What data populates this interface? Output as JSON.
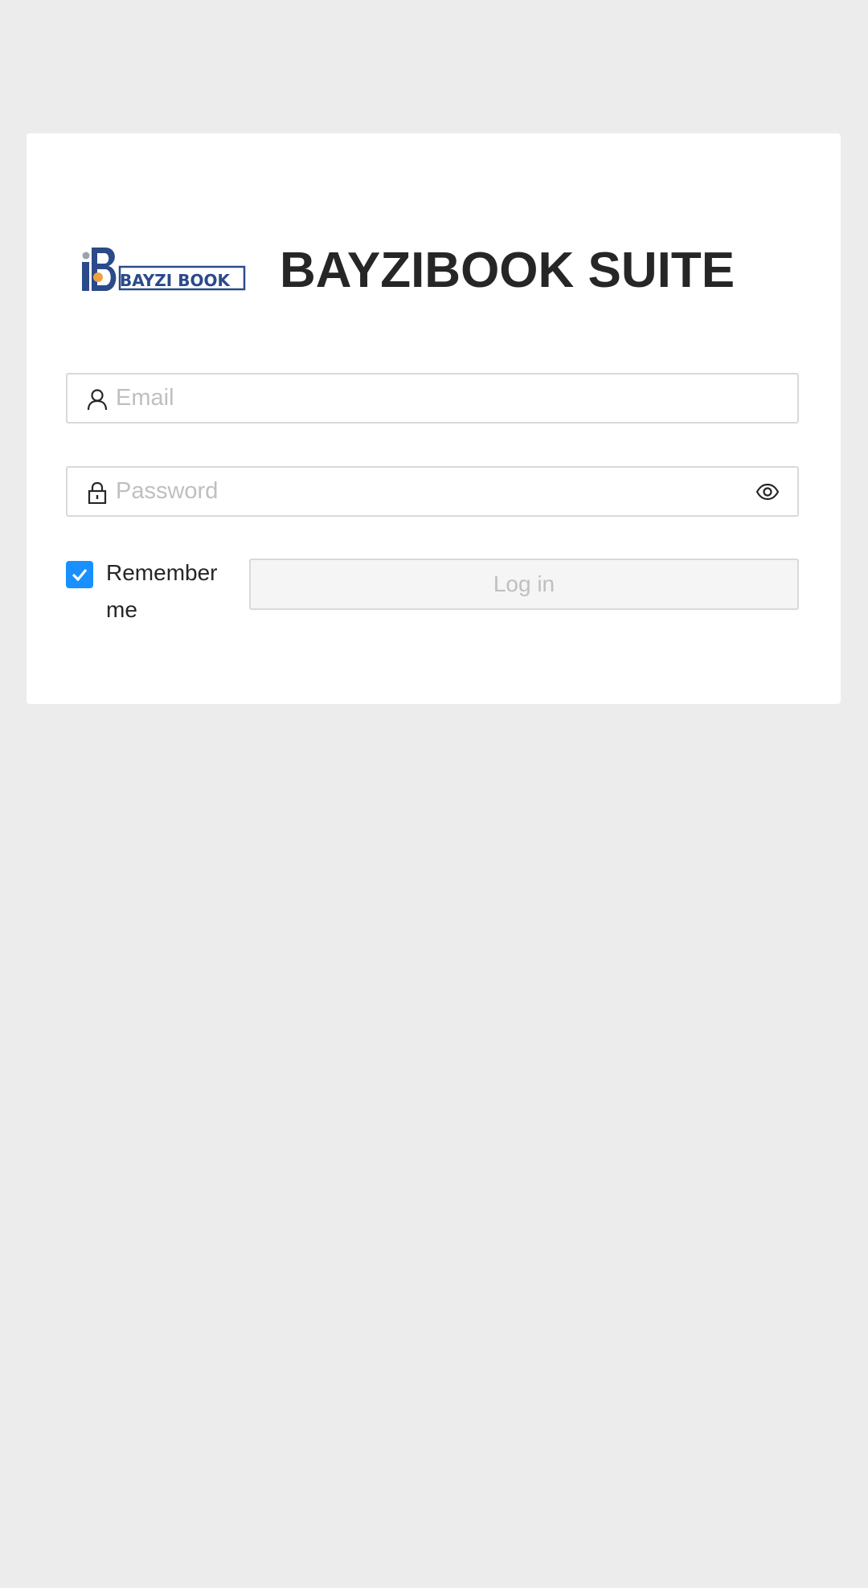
{
  "brand": {
    "logo_text": "BAYZI BOOK",
    "title": "BAYZIBOOK SUITE"
  },
  "login_form": {
    "email": {
      "icon": "user-icon",
      "placeholder": "Email",
      "value": ""
    },
    "password": {
      "icon": "lock-icon",
      "placeholder": "Password",
      "value": "",
      "toggle_icon": "eye-icon"
    },
    "remember_me": {
      "label": "Remember me",
      "checked": true
    },
    "submit_label": "Log in"
  },
  "colors": {
    "background": "#ececec",
    "card": "#ffffff",
    "checkbox": "#1890ff",
    "logo_blue": "#2a4a8a",
    "logo_orange": "#f0a040",
    "logo_gray": "#9aa3ad"
  }
}
